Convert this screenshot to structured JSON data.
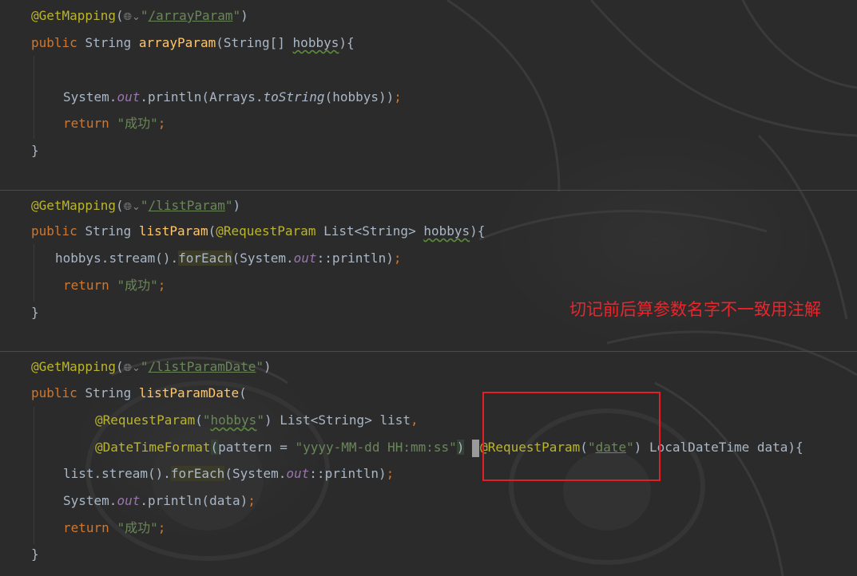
{
  "blocks": [
    {
      "annotation": "@GetMapping",
      "path": "/arrayParam",
      "signature": {
        "modifier": "public",
        "return_type": "String",
        "method": "arrayParam",
        "param_type": "String[]",
        "param_name": "hobbys"
      },
      "body": {
        "print_obj": "System",
        "print_field": "out",
        "print_method": "println",
        "arrays_class": "Arrays",
        "arrays_method": "toString",
        "arg": "hobbys",
        "return_kw": "return",
        "return_value": "\"成功\""
      }
    },
    {
      "annotation": "@GetMapping",
      "path": "/listParam",
      "signature": {
        "modifier": "public",
        "return_type": "String",
        "method": "listParam",
        "param_annotation": "@RequestParam",
        "param_type_outer": "List",
        "param_type_inner": "String",
        "param_name": "hobbys"
      },
      "body": {
        "receiver": "hobbys",
        "stream": "stream",
        "forEach": "forEach",
        "sys": "System",
        "out": "out",
        "println": "println",
        "return_kw": "return",
        "return_value": "\"成功\""
      }
    },
    {
      "annotation": "@GetMapping",
      "path": "/listParamDate",
      "signature": {
        "modifier": "public",
        "return_type": "String",
        "method": "listParamDate",
        "p1_annotation": "@RequestParam",
        "p1_value": "hobbys",
        "p1_type_outer": "List",
        "p1_type_inner": "String",
        "p1_name": "list",
        "p2_annotation": "@DateTimeFormat",
        "p2_attr": "pattern",
        "p2_pattern": "\"yyyy-MM-dd HH:mm:ss\"",
        "p3_annotation": "RequestParam",
        "p3_value": "date",
        "p3_type": "LocalDateTime",
        "p3_name": "data"
      },
      "body": {
        "receiver": "list",
        "stream": "stream",
        "forEach": "forEach",
        "sys": "System",
        "out": "out",
        "println": "println",
        "print_arg": "data",
        "return_kw": "return",
        "return_value": "\"成功\""
      }
    }
  ],
  "note": "切记前后算参数名字不一致用注解",
  "icons": {
    "gutter": "globe-chevron-icon"
  },
  "colors": {
    "keyword": "#cc7832",
    "annotation": "#bbb529",
    "string": "#6a8759",
    "method": "#ffc66d",
    "field": "#9876aa",
    "plain": "#a9b7c6",
    "note": "#e8262c",
    "highlight_box": "#e01f26"
  }
}
